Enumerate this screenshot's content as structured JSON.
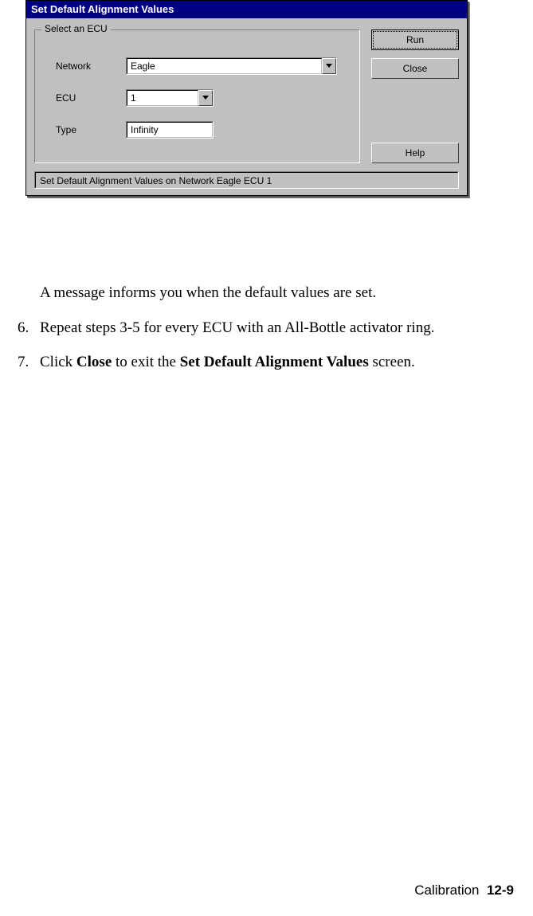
{
  "dialog": {
    "title": "Set Default Alignment Values",
    "group_legend": "Select an ECU",
    "network_label": "Network",
    "network_value": "Eagle",
    "ecu_label": "ECU",
    "ecu_value": "1",
    "type_label": "Type",
    "type_value": "Infinity",
    "run_label": "Run",
    "close_label": "Close",
    "help_label": "Help",
    "status": "Set Default Alignment Values on Network Eagle ECU 1"
  },
  "doc": {
    "msg_para": "A message informs you when the default values are set.",
    "step6_num": "6.",
    "step6_text": "Repeat steps 3-5 for every ECU with an All-Bottle activator ring.",
    "step7_num": "7.",
    "step7_pre": "Click ",
    "step7_b1": "Close",
    "step7_mid": " to exit the ",
    "step7_b2": "Set Default Alignment Values",
    "step7_post": " screen."
  },
  "footer": {
    "section": "Calibration",
    "page": "12-9"
  }
}
